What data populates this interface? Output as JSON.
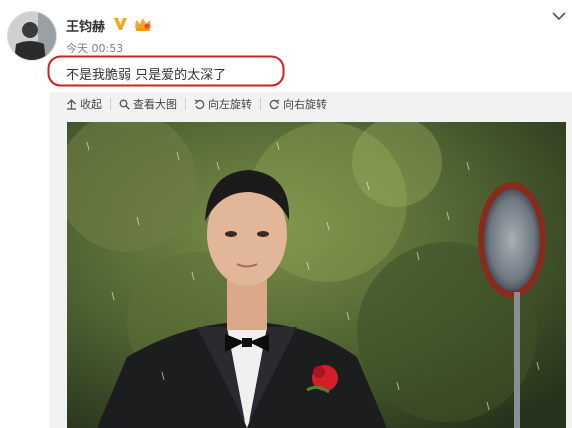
{
  "post": {
    "username": "王钧赫",
    "timestamp": "今天 00:53",
    "text": "不是我脆弱 只是爱的太深了"
  },
  "toolbar": {
    "collapse": "收起",
    "view_large": "查看大图",
    "rotate_left": "向左旋转",
    "rotate_right": "向右旋转"
  },
  "icons": {
    "verified": "v-badge-icon",
    "vip": "vip-icon",
    "menu": "chevron-down-icon",
    "collapse": "arrow-up-icon",
    "view_large": "magnifier-icon",
    "rotate_left": "rotate-left-icon",
    "rotate_right": "rotate-right-icon"
  },
  "colors": {
    "highlight": "#cc2222",
    "verified": "#f6a623",
    "text": "#333333",
    "meta": "#808080"
  }
}
